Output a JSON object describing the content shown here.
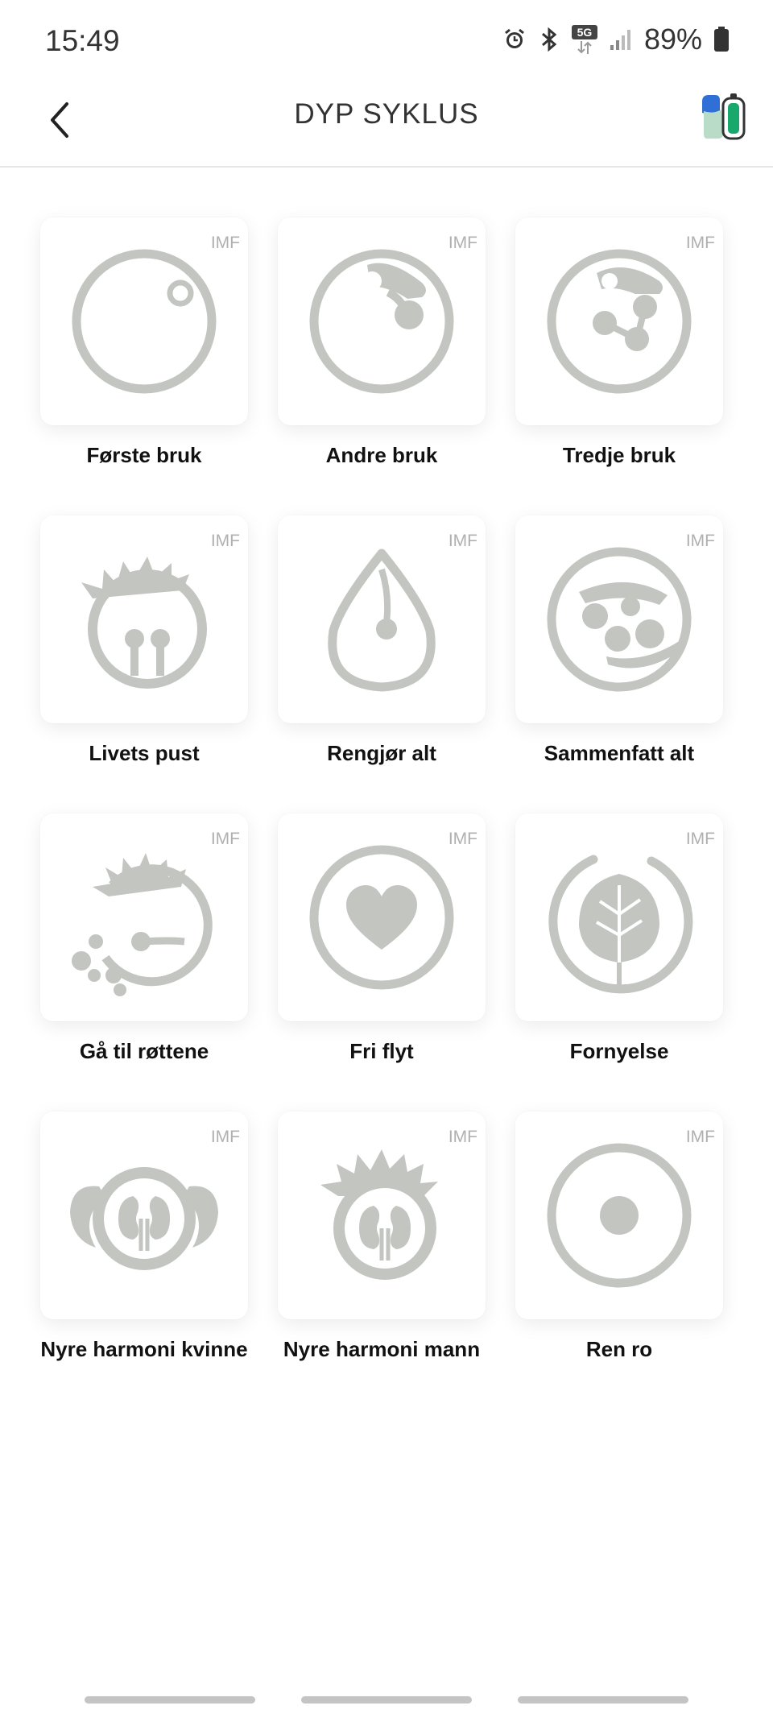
{
  "status_bar": {
    "time": "15:49",
    "network": "5G",
    "battery": "89%",
    "icons": [
      "alarm-icon",
      "bluetooth-icon",
      "5g-icon",
      "signal-icon",
      "battery-icon"
    ]
  },
  "header": {
    "title": "DYP SYKLUS",
    "back_icon": "chevron-left-icon",
    "device_icon": "device-status-icon"
  },
  "programs": [
    {
      "label": "Første bruk",
      "badge": "IMF",
      "icon": "first-use-icon"
    },
    {
      "label": "Andre bruk",
      "badge": "IMF",
      "icon": "second-use-icon"
    },
    {
      "label": "Tredje bruk",
      "badge": "IMF",
      "icon": "third-use-icon"
    },
    {
      "label": "Livets pust",
      "badge": "IMF",
      "icon": "breath-of-life-icon"
    },
    {
      "label": "Rengjør alt",
      "badge": "IMF",
      "icon": "drop-icon"
    },
    {
      "label": "Sammenfatt alt",
      "badge": "IMF",
      "icon": "summarize-all-icon"
    },
    {
      "label": "Gå til røttene",
      "badge": "IMF",
      "icon": "roots-icon"
    },
    {
      "label": "Fri flyt",
      "badge": "IMF",
      "icon": "heart-icon"
    },
    {
      "label": "Fornyelse",
      "badge": "IMF",
      "icon": "leaf-icon"
    },
    {
      "label": "Nyre harmoni kvinne",
      "badge": "IMF",
      "icon": "kidney-female-icon"
    },
    {
      "label": "Nyre harmoni mann",
      "badge": "IMF",
      "icon": "kidney-male-icon"
    },
    {
      "label": "Ren ro",
      "badge": "IMF",
      "icon": "pure-calm-icon"
    }
  ],
  "colors": {
    "icon_gray": "#c3c5c1",
    "accent_green": "#18a86b",
    "accent_blue": "#2f6fd6"
  }
}
